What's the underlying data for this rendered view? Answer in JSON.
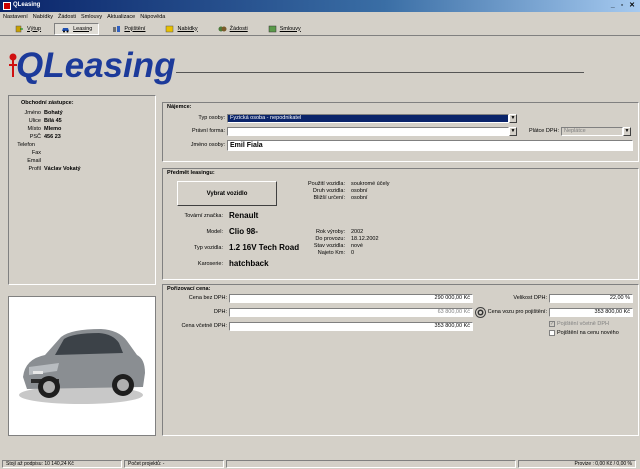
{
  "window": {
    "title": "QLeasing",
    "controls": "_ ▫ ✕"
  },
  "menu": [
    "Nastavení",
    "Nabídky",
    "Žádosti",
    "Smlouvy",
    "Aktualizace",
    "Nápověda"
  ],
  "toolbar": [
    {
      "label": "Výtup",
      "icon": "exit-icon"
    },
    {
      "label": "Leasing",
      "icon": "car-icon"
    },
    {
      "label": "Pojištění",
      "icon": "insurance-icon"
    },
    {
      "label": "Nabídky",
      "icon": "offers-icon"
    },
    {
      "label": "Žádosti",
      "icon": "requests-icon"
    },
    {
      "label": "Smlouvy",
      "icon": "contracts-icon"
    }
  ],
  "logo": {
    "text": "QLeasing",
    "mark": "ǂ"
  },
  "dealer": {
    "title": "Obchodní zástupce:",
    "rows": [
      {
        "label": "Jméno",
        "value": "Bohatý"
      },
      {
        "label": "Ulice",
        "value": "Bílá 45"
      },
      {
        "label": "Místo",
        "value": "Mlemo"
      },
      {
        "label": "PSČ",
        "value": "456 23"
      },
      {
        "label": "Telefon",
        "value": ""
      },
      {
        "label": "Fax",
        "value": ""
      },
      {
        "label": "Email",
        "value": ""
      },
      {
        "label": "Profil",
        "value": "Václav Vokatý"
      }
    ]
  },
  "lessee": {
    "title": "Nájemce:",
    "typ_osoby_label": "Typ osoby:",
    "typ_osoby_value": "Fyzická osoba - nepodnikatel",
    "pravni_forma_label": "Právní forma:",
    "pravni_forma_value": "",
    "platce_dph_label": "Plátce DPH:",
    "platce_dph_value": "Neplátce",
    "jmeno_label": "Jméno osoby:",
    "jmeno_value": "Emil Fiala"
  },
  "vehicle": {
    "title": "Předmět leasingu:",
    "select_button": "Vybrat vozidlo",
    "left": [
      {
        "label": "Tovární značka:",
        "value": "Renault"
      },
      {
        "label": "Model:",
        "value": "Clio 98-"
      },
      {
        "label": "Typ vozidla:",
        "value": "1.2 16V Tech Road"
      },
      {
        "label": "Karoserie:",
        "value": "hatchback"
      }
    ],
    "top_right": [
      {
        "label": "Použití vozidla:",
        "value": "soukromé účely"
      },
      {
        "label": "Druh vozidla:",
        "value": "osobní"
      },
      {
        "label": "Bližší určení:",
        "value": "osobní"
      }
    ],
    "bottom_right": [
      {
        "label": "Rok výroby:",
        "value": "2002"
      },
      {
        "label": "Do provozu:",
        "value": "18.12.2002"
      },
      {
        "label": "Stav vozidla:",
        "value": "nové"
      },
      {
        "label": "Najeto Km:",
        "value": "0"
      }
    ]
  },
  "price": {
    "title": "Pořizovací cena:",
    "bez_dph_label": "Cena bez DPH:",
    "bez_dph_value": "290 000,00 Kč",
    "dph_label": "DPH:",
    "dph_value": "63 800,00 Kč",
    "vcetne_label": "Cena včetně DPH:",
    "vcetne_value": "353 800,00 Kč",
    "velikost_label": "Velikost DPH:",
    "velikost_value": "22,00 %",
    "cena_pojisteni_label": "Cena vozu pro pojištění:",
    "cena_pojisteni_value": "353 800,00 Kč",
    "chk1_label": "Pojištění včetně DPH",
    "chk2_label": "Pojištění na cenu nového"
  },
  "status": [
    "Stojí až podpisu: 10 140,24 Kč",
    "Počet projektů: -",
    "",
    "Provize : 0,00 Kč / 0,00 %"
  ]
}
